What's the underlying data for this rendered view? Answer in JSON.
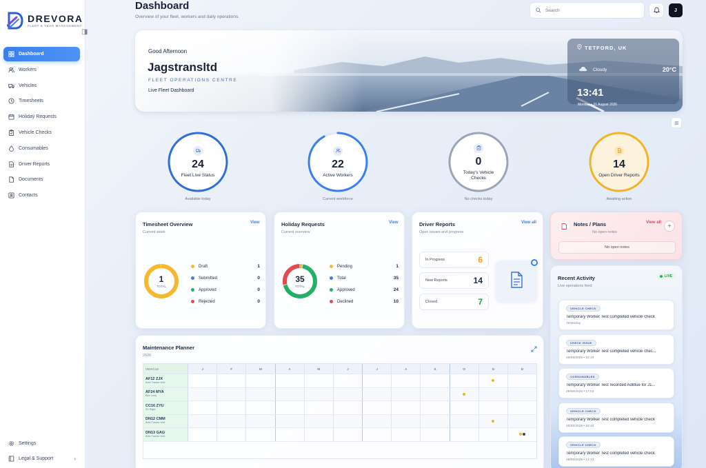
{
  "brand": {
    "name": "DREVORA",
    "tagline": "FLEET & YEAR MANAGEMENT"
  },
  "sidebar": {
    "items": [
      {
        "label": "Dashboard",
        "icon": "grid-icon",
        "active": true
      },
      {
        "label": "Workers",
        "icon": "users-icon"
      },
      {
        "label": "Vehicles",
        "icon": "truck-icon"
      },
      {
        "label": "Timesheets",
        "icon": "clock-icon"
      },
      {
        "label": "Holiday Requests",
        "icon": "calendar-icon"
      },
      {
        "label": "Vehicle Checks",
        "icon": "clipboard-icon"
      },
      {
        "label": "Consumables",
        "icon": "droplet-icon"
      },
      {
        "label": "Driver Reports",
        "icon": "file-icon"
      },
      {
        "label": "Documents",
        "icon": "document-icon"
      },
      {
        "label": "Contacts",
        "icon": "contact-icon"
      }
    ],
    "bottom": [
      {
        "label": "Settings",
        "icon": "gear-icon"
      },
      {
        "label": "Legal & Support",
        "icon": "book-icon",
        "chevron": "›"
      }
    ]
  },
  "header": {
    "title": "Dashboard",
    "subtitle": "Overview of your fleet, workers and daily operations.",
    "search_placeholder": "Search",
    "avatar_initial": "J"
  },
  "hero": {
    "greeting": "Good Afternoon",
    "company": "Jagstransltd",
    "centre": "FLEET OPERATIONS CENTRE",
    "tagline": "Live Fleet Dashboard",
    "weather": {
      "location": "TETFORD, UK",
      "condition": "Cloudy",
      "temperature": "20°C",
      "time": "13:41",
      "date": "Monday • 31 August 2026"
    }
  },
  "kpis": [
    {
      "value": "24",
      "label": "Fleet Live Status",
      "caption": "Available today",
      "color": "#2f6fd8",
      "fraction": 1.0,
      "icon": "truck-icon"
    },
    {
      "value": "22",
      "label": "Active Workers",
      "caption": "Current workforce",
      "color": "#3a7ff0",
      "fraction": 0.92,
      "icon": "users-icon"
    },
    {
      "value": "0",
      "label": "Today's Vehicle Checks",
      "caption": "No checks today",
      "color": "#9aa6b8",
      "fraction": 1.0,
      "icon": "clipboard-icon"
    },
    {
      "value": "14",
      "label": "Open Driver Reports",
      "caption": "Awaiting action",
      "color": "#f0b429",
      "fraction": 1.0,
      "icon": "file-icon"
    }
  ],
  "timesheet": {
    "title": "Timesheet Overview",
    "subtitle": "Current week",
    "link": "View",
    "total": "1",
    "total_label": "TOTAL",
    "legend": [
      {
        "label": "Draft",
        "value": "1",
        "color": "#f5b82e"
      },
      {
        "label": "Submitted",
        "value": "0",
        "color": "#3a7ff0"
      },
      {
        "label": "Approved",
        "value": "0",
        "color": "#22b067"
      },
      {
        "label": "Rejected",
        "value": "0",
        "color": "#e5484d"
      }
    ]
  },
  "holiday": {
    "title": "Holiday Requests",
    "subtitle": "Current overview",
    "link": "View",
    "total": "35",
    "total_label": "TOTAL",
    "legend": [
      {
        "label": "Pending",
        "value": "1",
        "color": "#f5b82e"
      },
      {
        "label": "Total",
        "value": "35",
        "color": "#3a7ff0"
      },
      {
        "label": "Approved",
        "value": "24",
        "color": "#22b067"
      },
      {
        "label": "Declined",
        "value": "10",
        "color": "#e5484d"
      }
    ]
  },
  "driver_reports": {
    "title": "Driver Reports",
    "subtitle": "Open issues and progress",
    "link": "View all",
    "rows": [
      {
        "label": "In Progress",
        "value": "6",
        "color": "#f0a020"
      },
      {
        "label": "New Reports",
        "value": "14",
        "color": "#1c2a44"
      },
      {
        "label": "Closed",
        "value": "7",
        "color": "#1e9a4a"
      }
    ]
  },
  "notes": {
    "title": "Notes / Plans",
    "subtitle": "No open notes",
    "link": "View all",
    "empty": "No open notes"
  },
  "activity": {
    "title": "Recent Activity",
    "subtitle": "Live operations feed",
    "badge": "LIVE",
    "items": [
      {
        "tag": "VEHICLE CHECK",
        "text": "Temporary Worker Test completed vehicle check",
        "time": "Yesterday"
      },
      {
        "tag": "CHECK ISSUE",
        "text": "Temporary Worker Test completed vehicle chec...",
        "time": "29/08/2026 • 22:19"
      },
      {
        "tag": "CONSUMABLES",
        "text": "Temporary Worker Test recorded AdBlue for J1...",
        "time": "29/08/2026 • 17:03"
      },
      {
        "tag": "VEHICLE CHECK",
        "text": "Temporary Worker Test completed vehicle check",
        "time": "29/08/2026 • 18:45"
      },
      {
        "tag": "VEHICLE CHECK",
        "text": "Temporary Worker Test completed vehicle check",
        "time": "29/08/2026 • 12:13"
      }
    ]
  },
  "maintenance": {
    "title": "Maintenance Planner",
    "year": "2026",
    "vehicle_header": "VEHICLE",
    "months": [
      "J",
      "F",
      "M",
      "A",
      "M",
      "J",
      "J",
      "A",
      "S",
      "O",
      "N",
      "D"
    ],
    "vehicles": [
      {
        "reg": "AF12 ZJX",
        "type": "Artic Tractor Unit",
        "marks": [
          {
            "month": 10,
            "colors": [
              "#f0b429"
            ]
          }
        ]
      },
      {
        "reg": "AF24 MYA",
        "type": "Box Lorry",
        "marks": [
          {
            "month": 9,
            "colors": [
              "#f0b429"
            ]
          }
        ]
      },
      {
        "reg": "CC16 ZYU",
        "type": "3X Rigid",
        "marks": []
      },
      {
        "reg": "DN12 CMM",
        "type": "Artic Tractor Unit",
        "marks": [
          {
            "month": 10,
            "colors": [
              "#f0b429"
            ]
          }
        ]
      },
      {
        "reg": "DN13 GAG",
        "type": "Artic Tractor Unit",
        "marks": [
          {
            "month": 11,
            "colors": [
              "#f0b429",
              "#3b4760"
            ]
          }
        ]
      }
    ]
  }
}
